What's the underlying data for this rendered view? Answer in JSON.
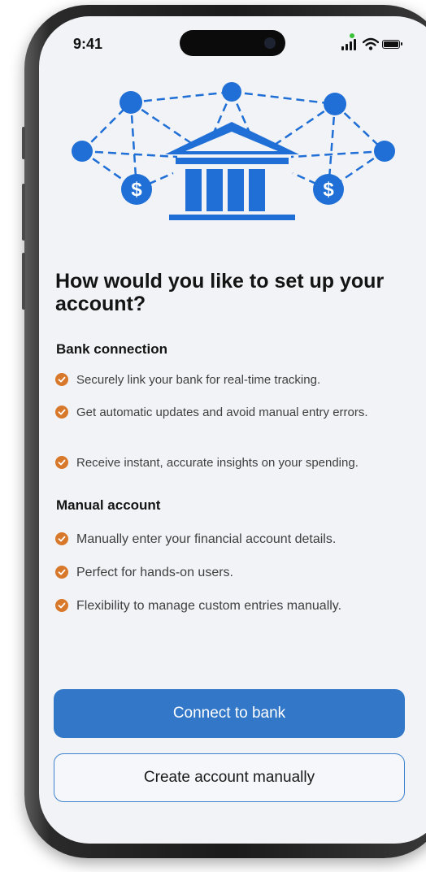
{
  "status_bar": {
    "time": "9:41"
  },
  "title": "How would you like to set up your account?",
  "bank_connection": {
    "heading": "Bank connection",
    "items": [
      "Securely link your bank for real-time tracking.",
      "Get automatic updates and avoid manual entry errors.",
      "Receive instant, accurate insights on your spending."
    ]
  },
  "manual_account": {
    "heading": "Manual account",
    "items": [
      "Manually enter your financial account details.",
      "Perfect for hands-on users.",
      "Flexibility to manage custom entries manually."
    ]
  },
  "buttons": {
    "connect_label": "Connect to bank",
    "manual_label": "Create account manually"
  },
  "illustration": {
    "dollar_symbol": "$"
  },
  "icons": {
    "illustration": "bank-network-icon",
    "bullet": "check-circle-icon",
    "signal": "cellular-signal-icon",
    "wifi": "wifi-icon",
    "battery": "battery-icon"
  },
  "colors": {
    "primary": "#3277c8",
    "illustration_blue": "#1f6fd6",
    "check_orange": "#d8782a",
    "screen_background": "#f2f3f7"
  }
}
